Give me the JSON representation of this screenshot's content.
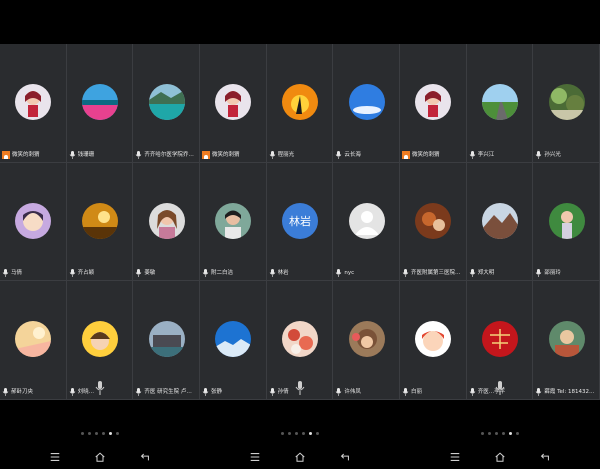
{
  "colors": {
    "background": "#000000",
    "tile": "#2a2c2f",
    "host_badge": "#ef7d22",
    "default_avatar": "#3b7dd8"
  },
  "participants": [
    {
      "name": "微笑的刺猬",
      "host": true,
      "avatar": "girl"
    },
    {
      "name": "钱珊珊",
      "host": false,
      "avatar": "pink-coast"
    },
    {
      "name": "齐齐哈尔医学院乔…",
      "host": false,
      "avatar": "lake"
    },
    {
      "name": "微笑的刺猬",
      "host": true,
      "avatar": "girl"
    },
    {
      "name": "程丽光",
      "host": false,
      "avatar": "sunset-bird"
    },
    {
      "name": "云长海",
      "host": false,
      "avatar": "sky"
    },
    {
      "name": "微笑的刺猬",
      "host": true,
      "avatar": "girl"
    },
    {
      "name": "李兴江",
      "host": false,
      "avatar": "road"
    },
    {
      "name": "孙兴光",
      "host": false,
      "avatar": "forest"
    },
    {
      "name": "马倩",
      "host": false,
      "avatar": "cartoon-girl"
    },
    {
      "name": "齐占颖",
      "host": false,
      "avatar": "golden"
    },
    {
      "name": "姜敏",
      "host": false,
      "avatar": "woman"
    },
    {
      "name": "附二白洁",
      "host": false,
      "avatar": "woman2"
    },
    {
      "name": "林岩",
      "host": false,
      "avatar": "text",
      "avatar_text": "林岩"
    },
    {
      "name": "nyc",
      "host": false,
      "avatar": "default"
    },
    {
      "name": "齐医附属第三医院…",
      "host": false,
      "avatar": "food"
    },
    {
      "name": "郑大明",
      "host": false,
      "avatar": "mountain"
    },
    {
      "name": "邵丽玲",
      "host": false,
      "avatar": "woman3"
    },
    {
      "name": "郝卧刀央",
      "host": false,
      "avatar": "pastel"
    },
    {
      "name": "刘晓…",
      "host": false,
      "avatar": "kid"
    },
    {
      "name": "齐医 研究生院 卢长方",
      "host": false,
      "avatar": "building"
    },
    {
      "name": "张静",
      "host": false,
      "avatar": "blue-sky"
    },
    {
      "name": "孙倩",
      "host": false,
      "avatar": "flowers"
    },
    {
      "name": "许伟凤",
      "host": false,
      "avatar": "monkey"
    },
    {
      "name": "白丽",
      "host": false,
      "avatar": "cartoon"
    },
    {
      "name": "齐医…李平",
      "host": false,
      "avatar": "red-calligraphy"
    },
    {
      "name": "薛霞 Tel: 18143202…",
      "host": false,
      "avatar": "painting"
    }
  ],
  "pager": {
    "groups": 3,
    "dots_per_group": 6,
    "active_index": 4
  },
  "nav": {
    "menu_icon": "menu-icon",
    "home_icon": "home-icon",
    "back_icon": "back-icon"
  }
}
